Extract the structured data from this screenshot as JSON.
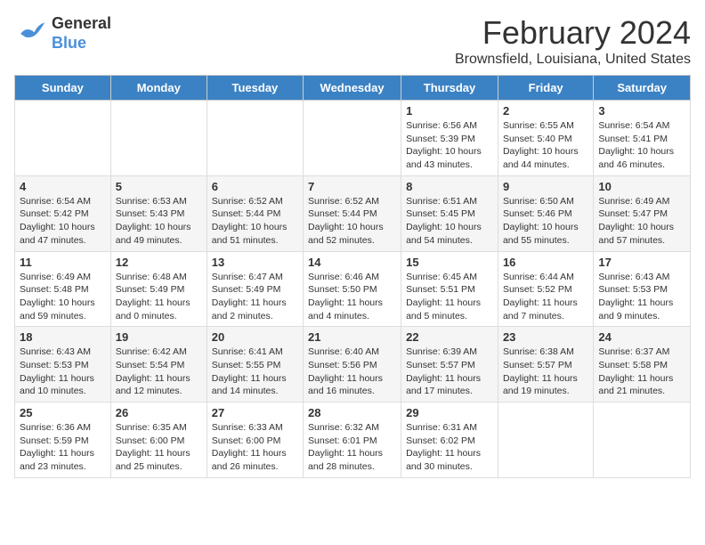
{
  "logo": {
    "line1": "General",
    "line2": "Blue"
  },
  "title": "February 2024",
  "subtitle": "Brownsfield, Louisiana, United States",
  "headers": [
    "Sunday",
    "Monday",
    "Tuesday",
    "Wednesday",
    "Thursday",
    "Friday",
    "Saturday"
  ],
  "weeks": [
    [
      {
        "day": "",
        "info": ""
      },
      {
        "day": "",
        "info": ""
      },
      {
        "day": "",
        "info": ""
      },
      {
        "day": "",
        "info": ""
      },
      {
        "day": "1",
        "info": "Sunrise: 6:56 AM\nSunset: 5:39 PM\nDaylight: 10 hours\nand 43 minutes."
      },
      {
        "day": "2",
        "info": "Sunrise: 6:55 AM\nSunset: 5:40 PM\nDaylight: 10 hours\nand 44 minutes."
      },
      {
        "day": "3",
        "info": "Sunrise: 6:54 AM\nSunset: 5:41 PM\nDaylight: 10 hours\nand 46 minutes."
      }
    ],
    [
      {
        "day": "4",
        "info": "Sunrise: 6:54 AM\nSunset: 5:42 PM\nDaylight: 10 hours\nand 47 minutes."
      },
      {
        "day": "5",
        "info": "Sunrise: 6:53 AM\nSunset: 5:43 PM\nDaylight: 10 hours\nand 49 minutes."
      },
      {
        "day": "6",
        "info": "Sunrise: 6:52 AM\nSunset: 5:44 PM\nDaylight: 10 hours\nand 51 minutes."
      },
      {
        "day": "7",
        "info": "Sunrise: 6:52 AM\nSunset: 5:44 PM\nDaylight: 10 hours\nand 52 minutes."
      },
      {
        "day": "8",
        "info": "Sunrise: 6:51 AM\nSunset: 5:45 PM\nDaylight: 10 hours\nand 54 minutes."
      },
      {
        "day": "9",
        "info": "Sunrise: 6:50 AM\nSunset: 5:46 PM\nDaylight: 10 hours\nand 55 minutes."
      },
      {
        "day": "10",
        "info": "Sunrise: 6:49 AM\nSunset: 5:47 PM\nDaylight: 10 hours\nand 57 minutes."
      }
    ],
    [
      {
        "day": "11",
        "info": "Sunrise: 6:49 AM\nSunset: 5:48 PM\nDaylight: 10 hours\nand 59 minutes."
      },
      {
        "day": "12",
        "info": "Sunrise: 6:48 AM\nSunset: 5:49 PM\nDaylight: 11 hours\nand 0 minutes."
      },
      {
        "day": "13",
        "info": "Sunrise: 6:47 AM\nSunset: 5:49 PM\nDaylight: 11 hours\nand 2 minutes."
      },
      {
        "day": "14",
        "info": "Sunrise: 6:46 AM\nSunset: 5:50 PM\nDaylight: 11 hours\nand 4 minutes."
      },
      {
        "day": "15",
        "info": "Sunrise: 6:45 AM\nSunset: 5:51 PM\nDaylight: 11 hours\nand 5 minutes."
      },
      {
        "day": "16",
        "info": "Sunrise: 6:44 AM\nSunset: 5:52 PM\nDaylight: 11 hours\nand 7 minutes."
      },
      {
        "day": "17",
        "info": "Sunrise: 6:43 AM\nSunset: 5:53 PM\nDaylight: 11 hours\nand 9 minutes."
      }
    ],
    [
      {
        "day": "18",
        "info": "Sunrise: 6:43 AM\nSunset: 5:53 PM\nDaylight: 11 hours\nand 10 minutes."
      },
      {
        "day": "19",
        "info": "Sunrise: 6:42 AM\nSunset: 5:54 PM\nDaylight: 11 hours\nand 12 minutes."
      },
      {
        "day": "20",
        "info": "Sunrise: 6:41 AM\nSunset: 5:55 PM\nDaylight: 11 hours\nand 14 minutes."
      },
      {
        "day": "21",
        "info": "Sunrise: 6:40 AM\nSunset: 5:56 PM\nDaylight: 11 hours\nand 16 minutes."
      },
      {
        "day": "22",
        "info": "Sunrise: 6:39 AM\nSunset: 5:57 PM\nDaylight: 11 hours\nand 17 minutes."
      },
      {
        "day": "23",
        "info": "Sunrise: 6:38 AM\nSunset: 5:57 PM\nDaylight: 11 hours\nand 19 minutes."
      },
      {
        "day": "24",
        "info": "Sunrise: 6:37 AM\nSunset: 5:58 PM\nDaylight: 11 hours\nand 21 minutes."
      }
    ],
    [
      {
        "day": "25",
        "info": "Sunrise: 6:36 AM\nSunset: 5:59 PM\nDaylight: 11 hours\nand 23 minutes."
      },
      {
        "day": "26",
        "info": "Sunrise: 6:35 AM\nSunset: 6:00 PM\nDaylight: 11 hours\nand 25 minutes."
      },
      {
        "day": "27",
        "info": "Sunrise: 6:33 AM\nSunset: 6:00 PM\nDaylight: 11 hours\nand 26 minutes."
      },
      {
        "day": "28",
        "info": "Sunrise: 6:32 AM\nSunset: 6:01 PM\nDaylight: 11 hours\nand 28 minutes."
      },
      {
        "day": "29",
        "info": "Sunrise: 6:31 AM\nSunset: 6:02 PM\nDaylight: 11 hours\nand 30 minutes."
      },
      {
        "day": "",
        "info": ""
      },
      {
        "day": "",
        "info": ""
      }
    ]
  ]
}
